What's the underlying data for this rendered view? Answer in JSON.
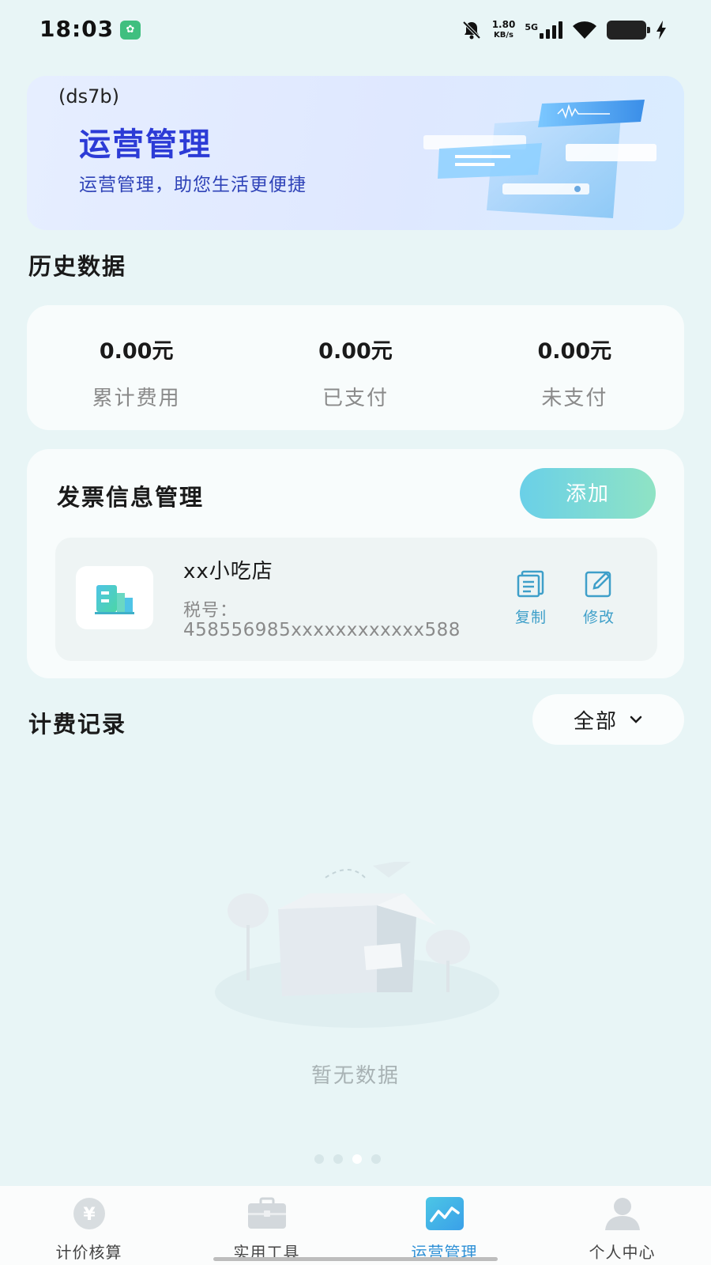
{
  "status_bar": {
    "time": "18:03",
    "net_speed_value": "1.80",
    "net_speed_unit": "KB/s",
    "network": "5G",
    "icons": [
      "app-notification-icon",
      "mute-bell-icon",
      "signal-icon",
      "wifi-icon",
      "battery-icon",
      "charging-icon"
    ]
  },
  "banner": {
    "code": "(ds7b)",
    "title": "运营管理",
    "subtitle": "运营管理，助您生活更便捷"
  },
  "history": {
    "title": "历史数据",
    "stats": [
      {
        "value": "0.00元",
        "label": "累计费用"
      },
      {
        "value": "0.00元",
        "label": "已支付"
      },
      {
        "value": "0.00元",
        "label": "未支付"
      }
    ]
  },
  "invoice": {
    "title": "发票信息管理",
    "add_label": "添加",
    "item": {
      "name": "xx小吃店",
      "tax_label": "税号：",
      "tax_value": "458556985xxxxxxxxxxxx588",
      "copy_label": "复制",
      "edit_label": "修改"
    }
  },
  "billing": {
    "title": "计费记录",
    "filter_value": "全部",
    "empty_text": "暂无数据"
  },
  "bottom_nav": {
    "items": [
      {
        "label": "计价核算",
        "icon": "yen-coin-icon",
        "active": false
      },
      {
        "label": "实用工具",
        "icon": "briefcase-icon",
        "active": false
      },
      {
        "label": "运营管理",
        "icon": "chart-trend-icon",
        "active": true
      },
      {
        "label": "个人中心",
        "icon": "person-icon",
        "active": false
      }
    ]
  },
  "colors": {
    "background": "#e8f5f6",
    "accent_blue": "#2c3bd6",
    "nav_active": "#2c8fd6",
    "action_blue": "#3e9fc9"
  }
}
